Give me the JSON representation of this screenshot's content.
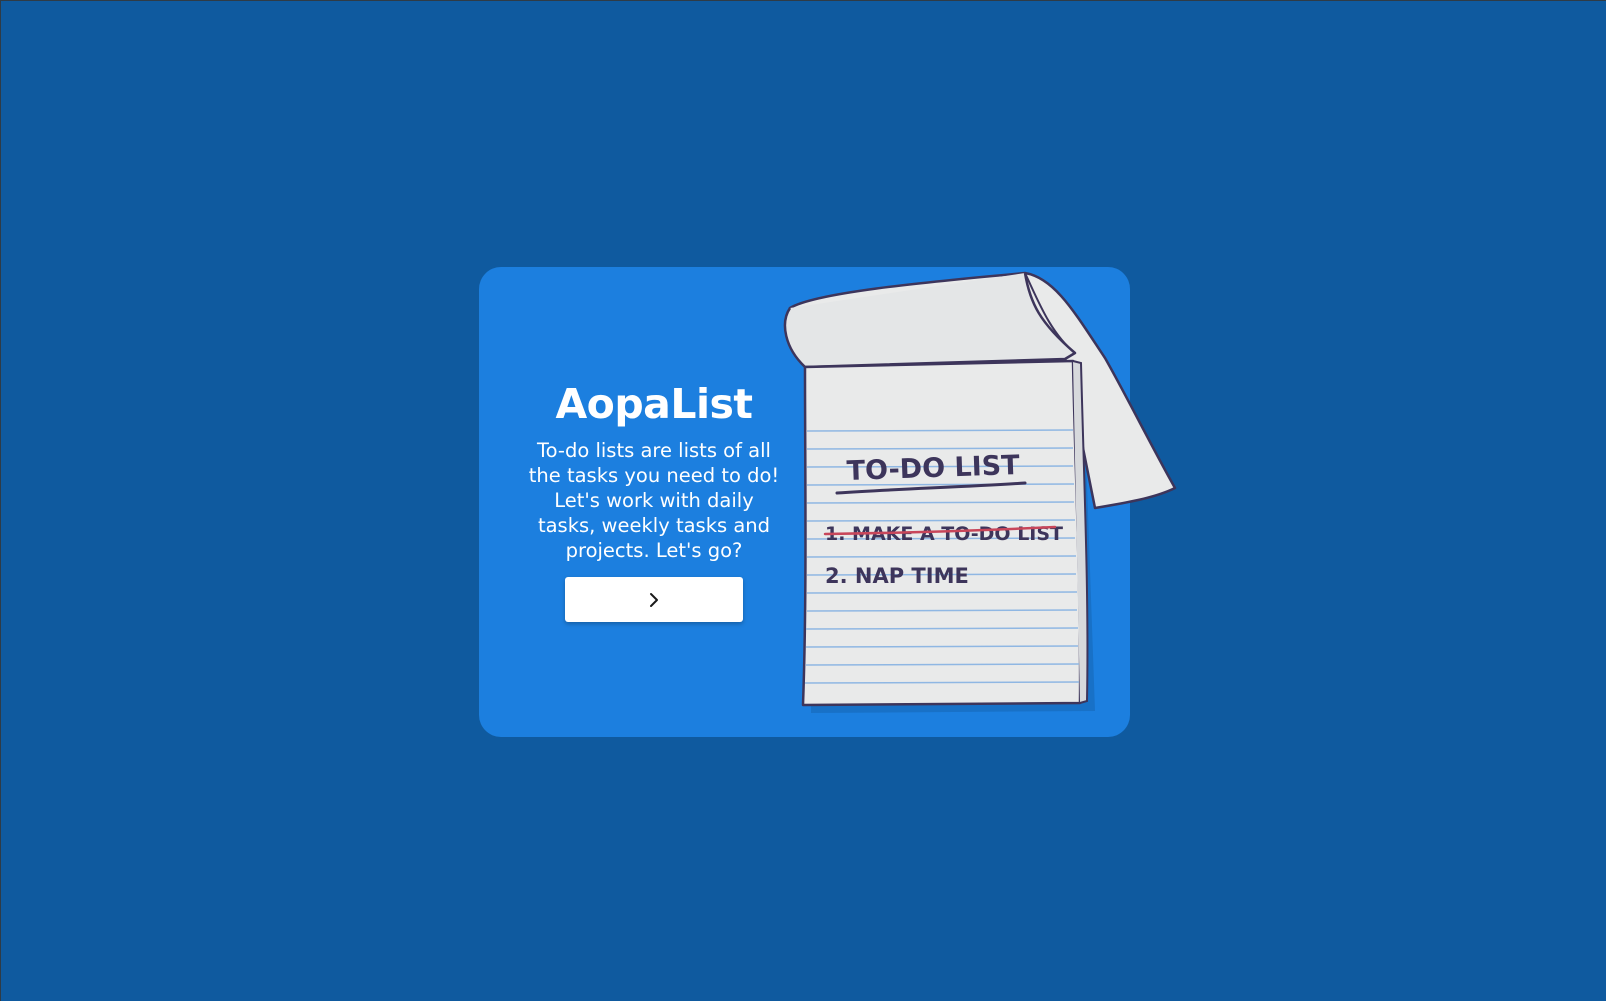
{
  "app": {
    "title": "AopaList",
    "description": "To-do lists are lists of all the tasks you need to do! Let's work with daily tasks, weekly tasks and projects. Let's go?"
  },
  "cta": {
    "icon": "chevron-right-icon"
  },
  "illustration": {
    "heading": "TO-DO LIST",
    "items": [
      "1. MAKE A TO-DO LIST",
      "2. NAP TIME"
    ]
  },
  "colors": {
    "page_background": "#0f5a9f",
    "card_background": "#1c7fdf",
    "button_background": "#ffffff",
    "note_ink": "#3d355b",
    "strike_red": "#c8465a",
    "paper": "#e9eaea",
    "ruled_line": "#8fb7e3"
  }
}
